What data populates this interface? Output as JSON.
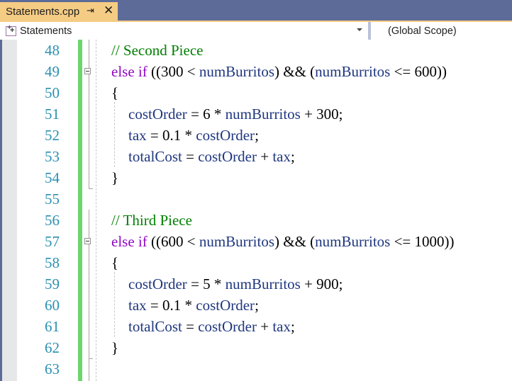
{
  "tab": {
    "title": "Statements.cpp",
    "pin_icon": "pin-icon",
    "close_icon": "close-icon"
  },
  "navbar": {
    "left_label": "Statements",
    "right_label": "(Global Scope)"
  },
  "colors": {
    "keyword": "#8f08c4",
    "variable": "#1f377f",
    "comment": "#008000",
    "line_number": "#2b91af",
    "change_bar": "#6cd66c",
    "tab_active": "#f5cc84",
    "chrome": "#5d6b99"
  },
  "lines": [
    {
      "n": "48",
      "tokens": [
        {
          "t": "// Second Piece",
          "c": "cm"
        }
      ]
    },
    {
      "n": "49",
      "tokens": [
        {
          "t": "else if",
          "c": "kw"
        },
        {
          "t": " ((300 < ",
          "c": ""
        },
        {
          "t": "numBurritos",
          "c": "var"
        },
        {
          "t": ") && (",
          "c": ""
        },
        {
          "t": "numBurritos",
          "c": "var"
        },
        {
          "t": " <= 600))",
          "c": ""
        }
      ]
    },
    {
      "n": "50",
      "tokens": [
        {
          "t": "{",
          "c": ""
        }
      ]
    },
    {
      "n": "51",
      "indent": true,
      "tokens": [
        {
          "t": "costOrder",
          "c": "var"
        },
        {
          "t": " = 6 * ",
          "c": ""
        },
        {
          "t": "numBurritos",
          "c": "var"
        },
        {
          "t": " + 300;",
          "c": ""
        }
      ]
    },
    {
      "n": "52",
      "indent": true,
      "tokens": [
        {
          "t": "tax",
          "c": "var"
        },
        {
          "t": " = 0.1 * ",
          "c": ""
        },
        {
          "t": "costOrder",
          "c": "var"
        },
        {
          "t": ";",
          "c": ""
        }
      ]
    },
    {
      "n": "53",
      "indent": true,
      "tokens": [
        {
          "t": "totalCost",
          "c": "var"
        },
        {
          "t": " = ",
          "c": ""
        },
        {
          "t": "costOrder",
          "c": "var"
        },
        {
          "t": " + ",
          "c": ""
        },
        {
          "t": "tax",
          "c": "var"
        },
        {
          "t": ";",
          "c": ""
        }
      ]
    },
    {
      "n": "54",
      "tokens": [
        {
          "t": "}",
          "c": ""
        }
      ]
    },
    {
      "n": "55",
      "tokens": []
    },
    {
      "n": "56",
      "tokens": [
        {
          "t": "// Third Piece",
          "c": "cm"
        }
      ]
    },
    {
      "n": "57",
      "tokens": [
        {
          "t": "else if",
          "c": "kw"
        },
        {
          "t": " ((600 < ",
          "c": ""
        },
        {
          "t": "numBurritos",
          "c": "var"
        },
        {
          "t": ") && (",
          "c": ""
        },
        {
          "t": "numBurritos",
          "c": "var"
        },
        {
          "t": " <= 1000))",
          "c": ""
        }
      ]
    },
    {
      "n": "58",
      "tokens": [
        {
          "t": "{",
          "c": ""
        }
      ]
    },
    {
      "n": "59",
      "indent": true,
      "tokens": [
        {
          "t": "costOrder",
          "c": "var"
        },
        {
          "t": " = 5 * ",
          "c": ""
        },
        {
          "t": "numBurritos",
          "c": "var"
        },
        {
          "t": " + 900;",
          "c": ""
        }
      ]
    },
    {
      "n": "60",
      "indent": true,
      "tokens": [
        {
          "t": "tax",
          "c": "var"
        },
        {
          "t": " = 0.1 * ",
          "c": ""
        },
        {
          "t": "costOrder",
          "c": "var"
        },
        {
          "t": ";",
          "c": ""
        }
      ]
    },
    {
      "n": "61",
      "indent": true,
      "tokens": [
        {
          "t": "totalCost",
          "c": "var"
        },
        {
          "t": " = ",
          "c": ""
        },
        {
          "t": "costOrder",
          "c": "var"
        },
        {
          "t": " + ",
          "c": ""
        },
        {
          "t": "tax",
          "c": "var"
        },
        {
          "t": ";",
          "c": ""
        }
      ]
    },
    {
      "n": "62",
      "tokens": [
        {
          "t": "}",
          "c": ""
        }
      ]
    },
    {
      "n": "63",
      "tokens": []
    }
  ]
}
